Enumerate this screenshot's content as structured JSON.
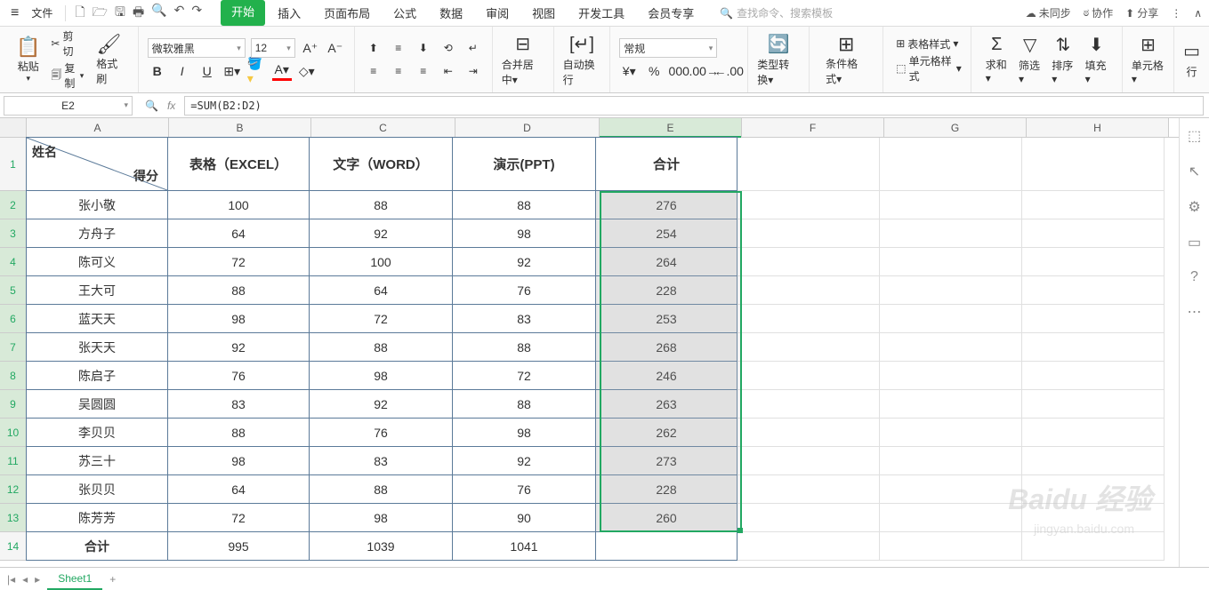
{
  "menu": {
    "file": "文件",
    "tabs": [
      "开始",
      "插入",
      "页面布局",
      "公式",
      "数据",
      "审阅",
      "视图",
      "开发工具",
      "会员专享"
    ],
    "active_tab": "开始",
    "search_placeholder": "查找命令、搜索模板",
    "unsync": "未同步",
    "collab": "协作",
    "share": "分享"
  },
  "ribbon": {
    "paste": "粘贴",
    "cut": "剪切",
    "copy": "复制",
    "format_painter": "格式刷",
    "font_name": "微软雅黑",
    "font_size": "12",
    "merge_center": "合并居中",
    "auto_wrap": "自动换行",
    "number_format": "常规",
    "type_convert": "类型转换",
    "cond_format": "条件格式",
    "table_style": "表格样式",
    "cell_style": "单元格样式",
    "sum": "求和",
    "filter": "筛选",
    "sort": "排序",
    "fill": "填充",
    "cells": "单元格",
    "row": "行"
  },
  "formula_bar": {
    "name_box": "E2",
    "formula": "=SUM(B2:D2)"
  },
  "columns": [
    "A",
    "B",
    "C",
    "D",
    "E",
    "F",
    "G",
    "H"
  ],
  "header_row": {
    "diag_top": "姓名",
    "diag_bottom": "得分",
    "b": "表格（EXCEL）",
    "c": "文字（WORD）",
    "d": "演示(PPT)",
    "e": "合计"
  },
  "rows": [
    {
      "name": "张小敬",
      "b": "100",
      "c": "88",
      "d": "88",
      "e": "276"
    },
    {
      "name": "方舟子",
      "b": "64",
      "c": "92",
      "d": "98",
      "e": "254"
    },
    {
      "name": "陈可义",
      "b": "72",
      "c": "100",
      "d": "92",
      "e": "264"
    },
    {
      "name": "王大可",
      "b": "88",
      "c": "64",
      "d": "76",
      "e": "228"
    },
    {
      "name": "蓝天天",
      "b": "98",
      "c": "72",
      "d": "83",
      "e": "253"
    },
    {
      "name": "张天天",
      "b": "92",
      "c": "88",
      "d": "88",
      "e": "268"
    },
    {
      "name": "陈启子",
      "b": "76",
      "c": "98",
      "d": "72",
      "e": "246"
    },
    {
      "name": "吴圆圆",
      "b": "83",
      "c": "92",
      "d": "88",
      "e": "263"
    },
    {
      "name": "李贝贝",
      "b": "88",
      "c": "76",
      "d": "98",
      "e": "262"
    },
    {
      "name": "苏三十",
      "b": "98",
      "c": "83",
      "d": "92",
      "e": "273"
    },
    {
      "name": "张贝贝",
      "b": "64",
      "c": "88",
      "d": "76",
      "e": "228"
    },
    {
      "name": "陈芳芳",
      "b": "72",
      "c": "98",
      "d": "90",
      "e": "260"
    }
  ],
  "totals": {
    "name": "合计",
    "b": "995",
    "c": "1039",
    "d": "1041",
    "e": ""
  },
  "sheet_tab": "Sheet1",
  "watermark": "Baidu 经验",
  "watermark_sub": "jingyan.baidu.com"
}
